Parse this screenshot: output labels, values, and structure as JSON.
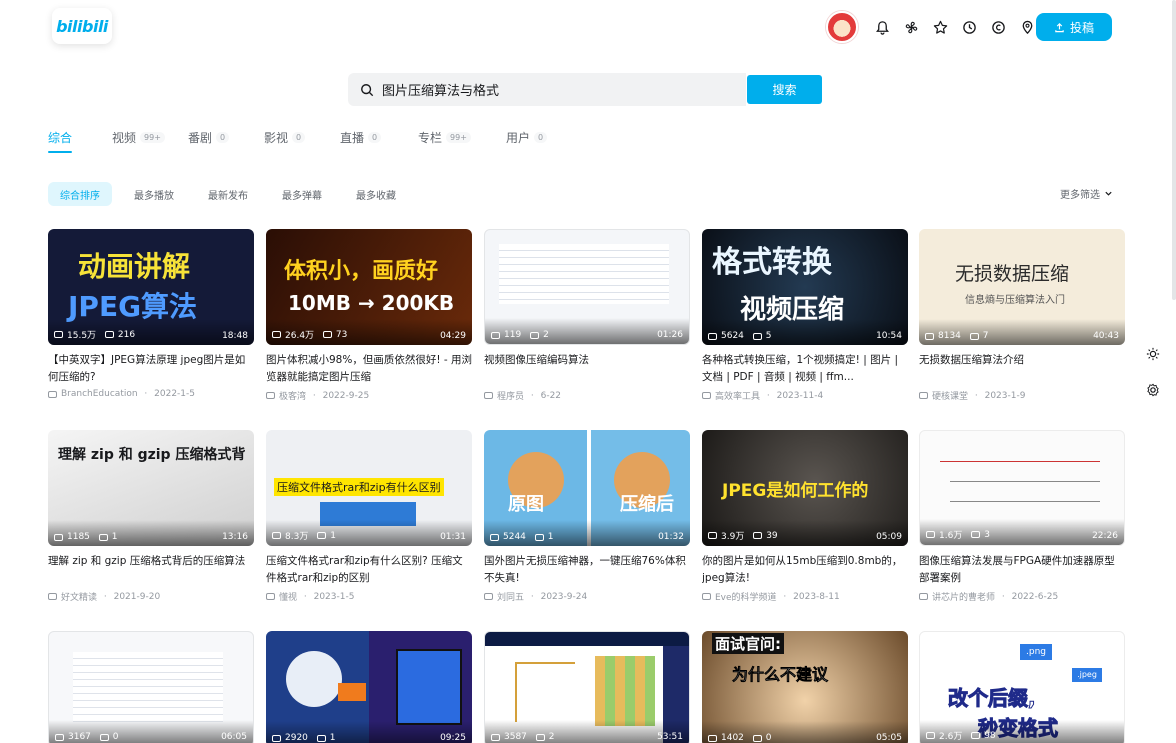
{
  "header": {
    "logo": "bilibili",
    "upload_label": "投稿",
    "icons": [
      "bell-icon",
      "fan-icon",
      "star-icon",
      "clock-icon",
      "bcoin-icon",
      "location-icon"
    ]
  },
  "search": {
    "value": "图片压缩算法与格式",
    "button": "搜索"
  },
  "tabs": [
    {
      "label": "综合",
      "count": ""
    },
    {
      "label": "视频",
      "count": "99+"
    },
    {
      "label": "番剧",
      "count": "0"
    },
    {
      "label": "影视",
      "count": "0"
    },
    {
      "label": "直播",
      "count": "0"
    },
    {
      "label": "专栏",
      "count": "99+"
    },
    {
      "label": "用户",
      "count": "0"
    }
  ],
  "sorts": [
    "综合排序",
    "最多播放",
    "最新发布",
    "最多弹幕",
    "最多收藏"
  ],
  "more_filter": "更多筛选",
  "videos": [
    {
      "thumb_text": "动画讲解",
      "thumb_text2": "JPEG算法",
      "plays": "15.5万",
      "danmaku": "216",
      "duration": "18:48",
      "title": "【中英双字】JPEG算法原理 jpeg图片是如何压缩的?",
      "author": "BranchEducation",
      "date": "2022-1-5"
    },
    {
      "thumb_text": "体积小，画质好",
      "thumb_text2": "10MB → 200KB",
      "plays": "26.4万",
      "danmaku": "73",
      "duration": "04:29",
      "title": "图片体积减小98%，但画质依然很好! - 用浏览器就能搞定图片压缩",
      "author": "极客湾",
      "date": "2022-9-25"
    },
    {
      "thumb_text": "",
      "thumb_text2": "",
      "plays": "119",
      "danmaku": "2",
      "duration": "01:26",
      "title": "视频图像压缩编码算法",
      "author": "程序员",
      "date": "6-22"
    },
    {
      "thumb_text": "格式转换",
      "thumb_text2": "视频压缩",
      "plays": "5624",
      "danmaku": "5",
      "duration": "10:54",
      "title": "各种格式转换压缩，1个视频搞定! | 图片 | 文档 | PDF | 音频 | 视频 | ffm...",
      "author": "高效率工具",
      "date": "2023-11-4"
    },
    {
      "thumb_text": "无损数据压缩",
      "thumb_text2": "信息熵与压缩算法入门",
      "plays": "8134",
      "danmaku": "7",
      "duration": "40:43",
      "title": "无损数据压缩算法介绍",
      "author": "硬核课堂",
      "date": "2023-1-9"
    },
    {
      "thumb_text": "理解 zip 和 gzip 压缩格式背",
      "thumb_text2": "",
      "plays": "1185",
      "danmaku": "1",
      "duration": "13:16",
      "title": "理解 zip 和 gzip 压缩格式背后的压缩算法",
      "author": "好文精读",
      "date": "2021-9-20"
    },
    {
      "thumb_text": "压缩文件格式rar和zip有什么区别",
      "thumb_text2": "",
      "plays": "8.3万",
      "danmaku": "1",
      "duration": "01:31",
      "title": "压缩文件格式rar和zip有什么区别? 压缩文件格式rar和zip的区别",
      "author": "懂视",
      "date": "2023-1-5"
    },
    {
      "thumb_text": "原图",
      "thumb_text2": "压缩后",
      "plays": "5244",
      "danmaku": "1",
      "duration": "01:32",
      "title": "国外图片无损压缩神器，一键压缩76%体积不失真!",
      "author": "刘同五",
      "date": "2023-9-24"
    },
    {
      "thumb_text": "JPEG是如何工作的",
      "thumb_text2": "",
      "plays": "3.9万",
      "danmaku": "39",
      "duration": "05:09",
      "title": "你的图片是如何从15mb压缩到0.8mb的，jpeg算法!",
      "author": "Eve的科学频道",
      "date": "2023-8-11"
    },
    {
      "thumb_text": "",
      "thumb_text2": "",
      "plays": "1.6万",
      "danmaku": "3",
      "duration": "22:26",
      "title": "图像压缩算法发展与FPGA硬件加速器原型部署案例",
      "author": "讲芯片的曹老师",
      "date": "2022-6-25"
    },
    {
      "thumb_text": "",
      "thumb_text2": "",
      "plays": "3167",
      "danmaku": "0",
      "duration": "06:05",
      "title": "",
      "author": "",
      "date": ""
    },
    {
      "thumb_text": "",
      "thumb_text2": "",
      "plays": "2920",
      "danmaku": "1",
      "duration": "09:25",
      "title": "",
      "author": "",
      "date": ""
    },
    {
      "thumb_text": "",
      "thumb_text2": "",
      "plays": "3587",
      "danmaku": "2",
      "duration": "53:51",
      "title": "",
      "author": "",
      "date": ""
    },
    {
      "thumb_text": "面试官问:",
      "thumb_text2": "为什么不建议",
      "plays": "1402",
      "danmaku": "0",
      "duration": "05:05",
      "title": "",
      "author": "",
      "date": ""
    },
    {
      "thumb_text": "改个后缀,",
      "thumb_text2": "秒变格式",
      "plays": "2.6万",
      "danmaku": "98",
      "duration": "",
      "title": "",
      "author": "",
      "date": ""
    }
  ]
}
